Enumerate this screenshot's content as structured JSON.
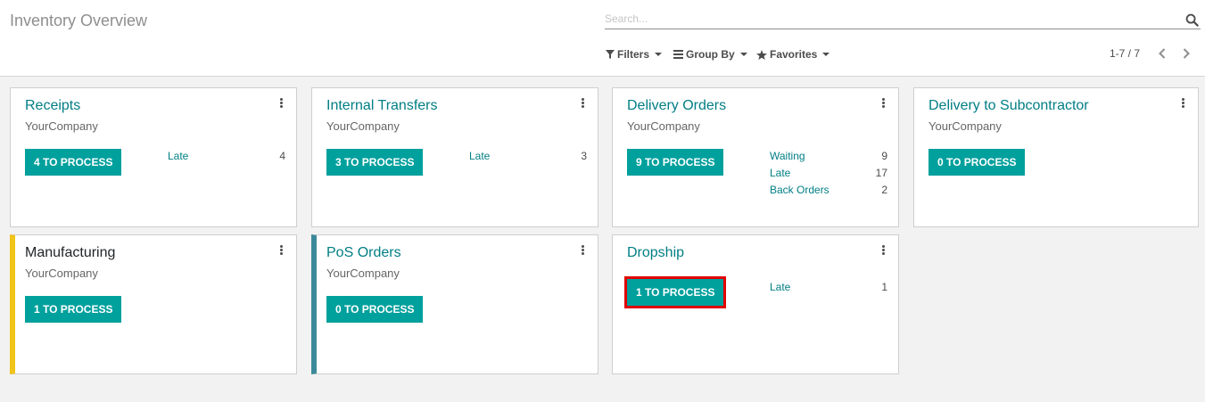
{
  "header": {
    "title": "Inventory Overview",
    "search_placeholder": "Search...",
    "filters_label": "Filters",
    "group_by_label": "Group By",
    "favorites_label": "Favorites",
    "pager": "1-7 / 7"
  },
  "colors": {
    "accent": "#00a09d",
    "link": "#017e84",
    "manufacturing_bar": "#f0c419",
    "pos_bar": "#3a8a9a",
    "highlight": "#e00000"
  },
  "cards": [
    {
      "title": "Receipts",
      "company": "YourCompany",
      "button": "4 TO PROCESS",
      "stats": [
        {
          "label": "Late",
          "value": "4"
        }
      ]
    },
    {
      "title": "Internal Transfers",
      "company": "YourCompany",
      "button": "3 TO PROCESS",
      "stats": [
        {
          "label": "Late",
          "value": "3"
        }
      ]
    },
    {
      "title": "Delivery Orders",
      "company": "YourCompany",
      "button": "9 TO PROCESS",
      "stats": [
        {
          "label": "Waiting",
          "value": "9"
        },
        {
          "label": "Late",
          "value": "17"
        },
        {
          "label": "Back Orders",
          "value": "2"
        }
      ]
    },
    {
      "title": "Delivery to Subcontractor",
      "company": "YourCompany",
      "button": "0 TO PROCESS",
      "stats": []
    },
    {
      "title": "Manufacturing",
      "company": "YourCompany",
      "button": "1 TO PROCESS",
      "stats": []
    },
    {
      "title": "PoS Orders",
      "company": "YourCompany",
      "button": "0 TO PROCESS",
      "stats": []
    },
    {
      "title": "Dropship",
      "company": "YourCompany",
      "button": "1 TO PROCESS",
      "stats": [
        {
          "label": "Late",
          "value": "1"
        }
      ]
    }
  ]
}
